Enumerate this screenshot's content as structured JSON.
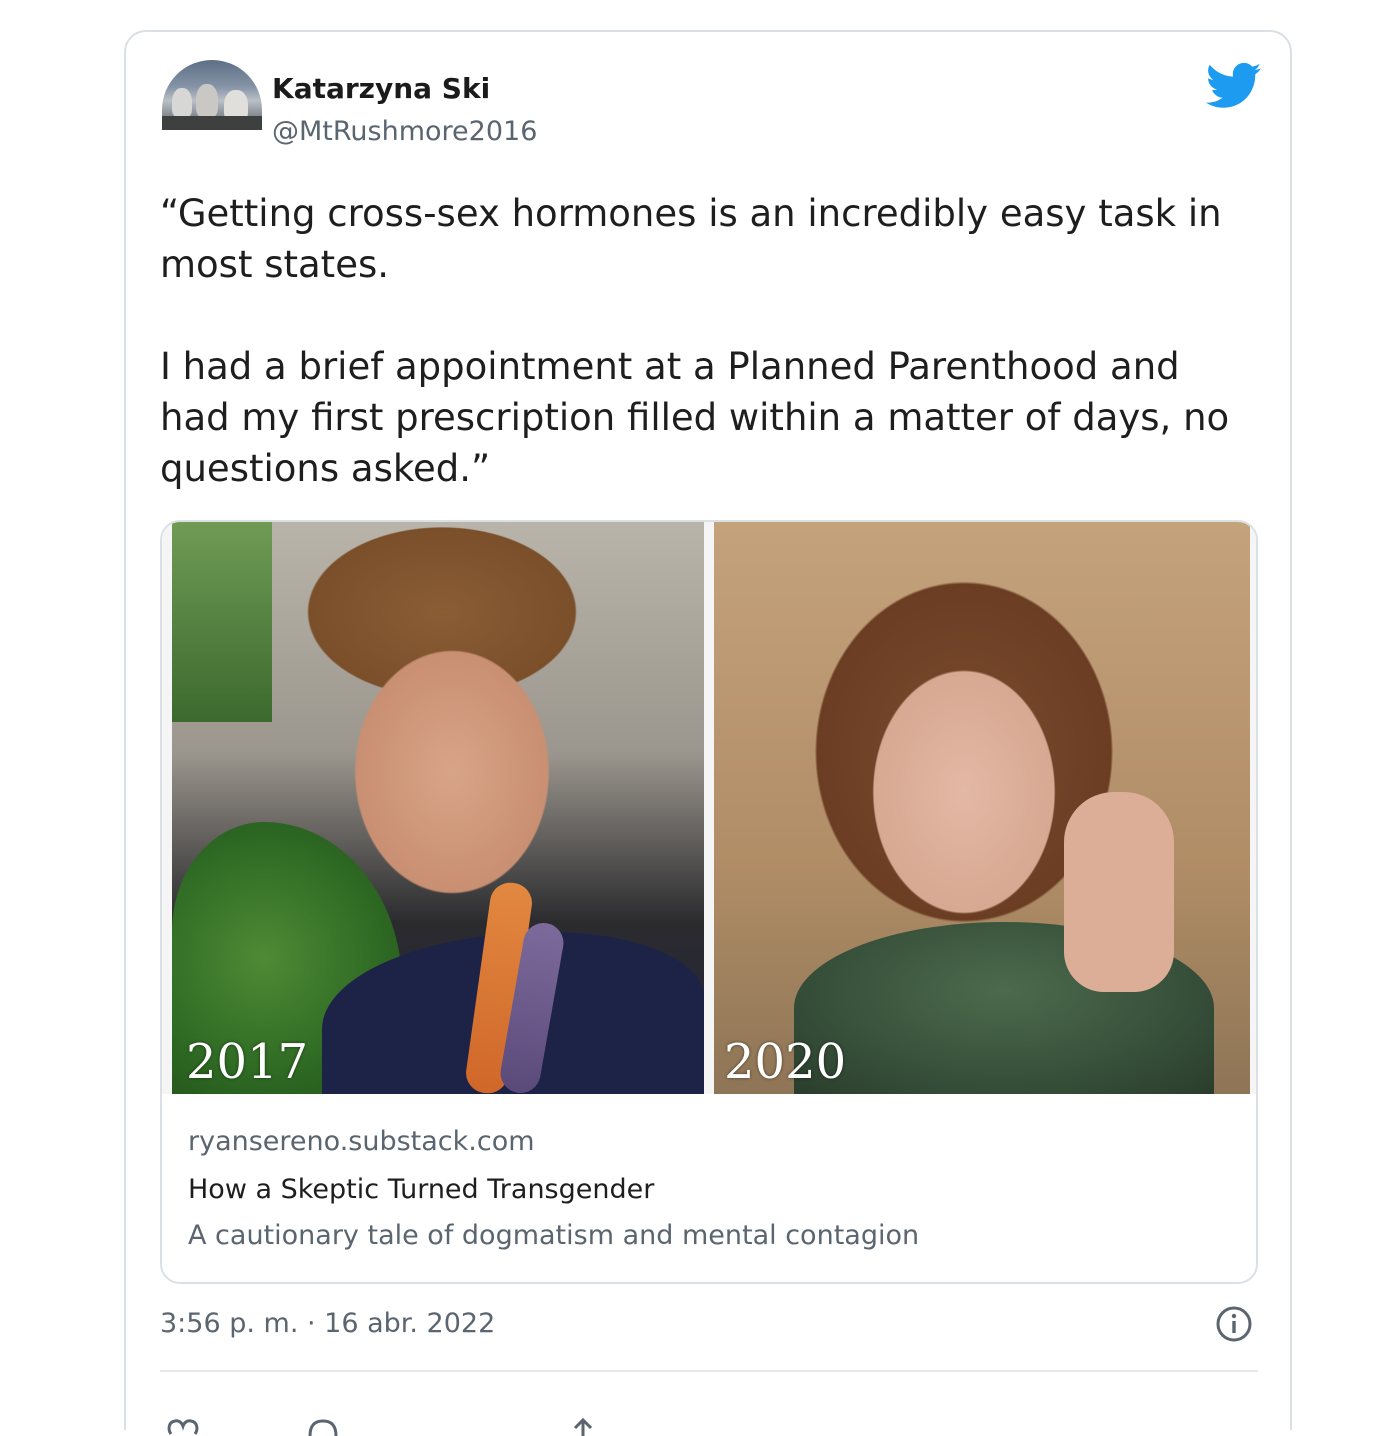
{
  "tweet": {
    "author_name": "Katarzyna Ski",
    "author_handle": "@MtRushmore2016",
    "text": "“Getting cross-sex hormones is an incredibly easy task in most states.\n\nI had a brief appointment at a Planned Parenthood and had my first prescription filled within a matter of days, no questions asked.”",
    "timestamp": "3:56 p. m. · 16 abr. 2022"
  },
  "link_card": {
    "domain": "ryansereno.substack.com",
    "title": "How a Skeptic Turned Transgender",
    "description": "A cautionary tale of dogmatism and mental contagion",
    "image_left_year": "2017",
    "image_right_year": "2020"
  },
  "icons": {
    "brand": "twitter-bird-icon",
    "info": "info-icon",
    "actions": [
      "like-icon",
      "reply-icon",
      "share-icon"
    ]
  },
  "colors": {
    "twitter_blue": "#1d9bf0",
    "text_primary": "#1e1e1e",
    "text_secondary": "#5b6570",
    "border": "#dbe0e4"
  }
}
